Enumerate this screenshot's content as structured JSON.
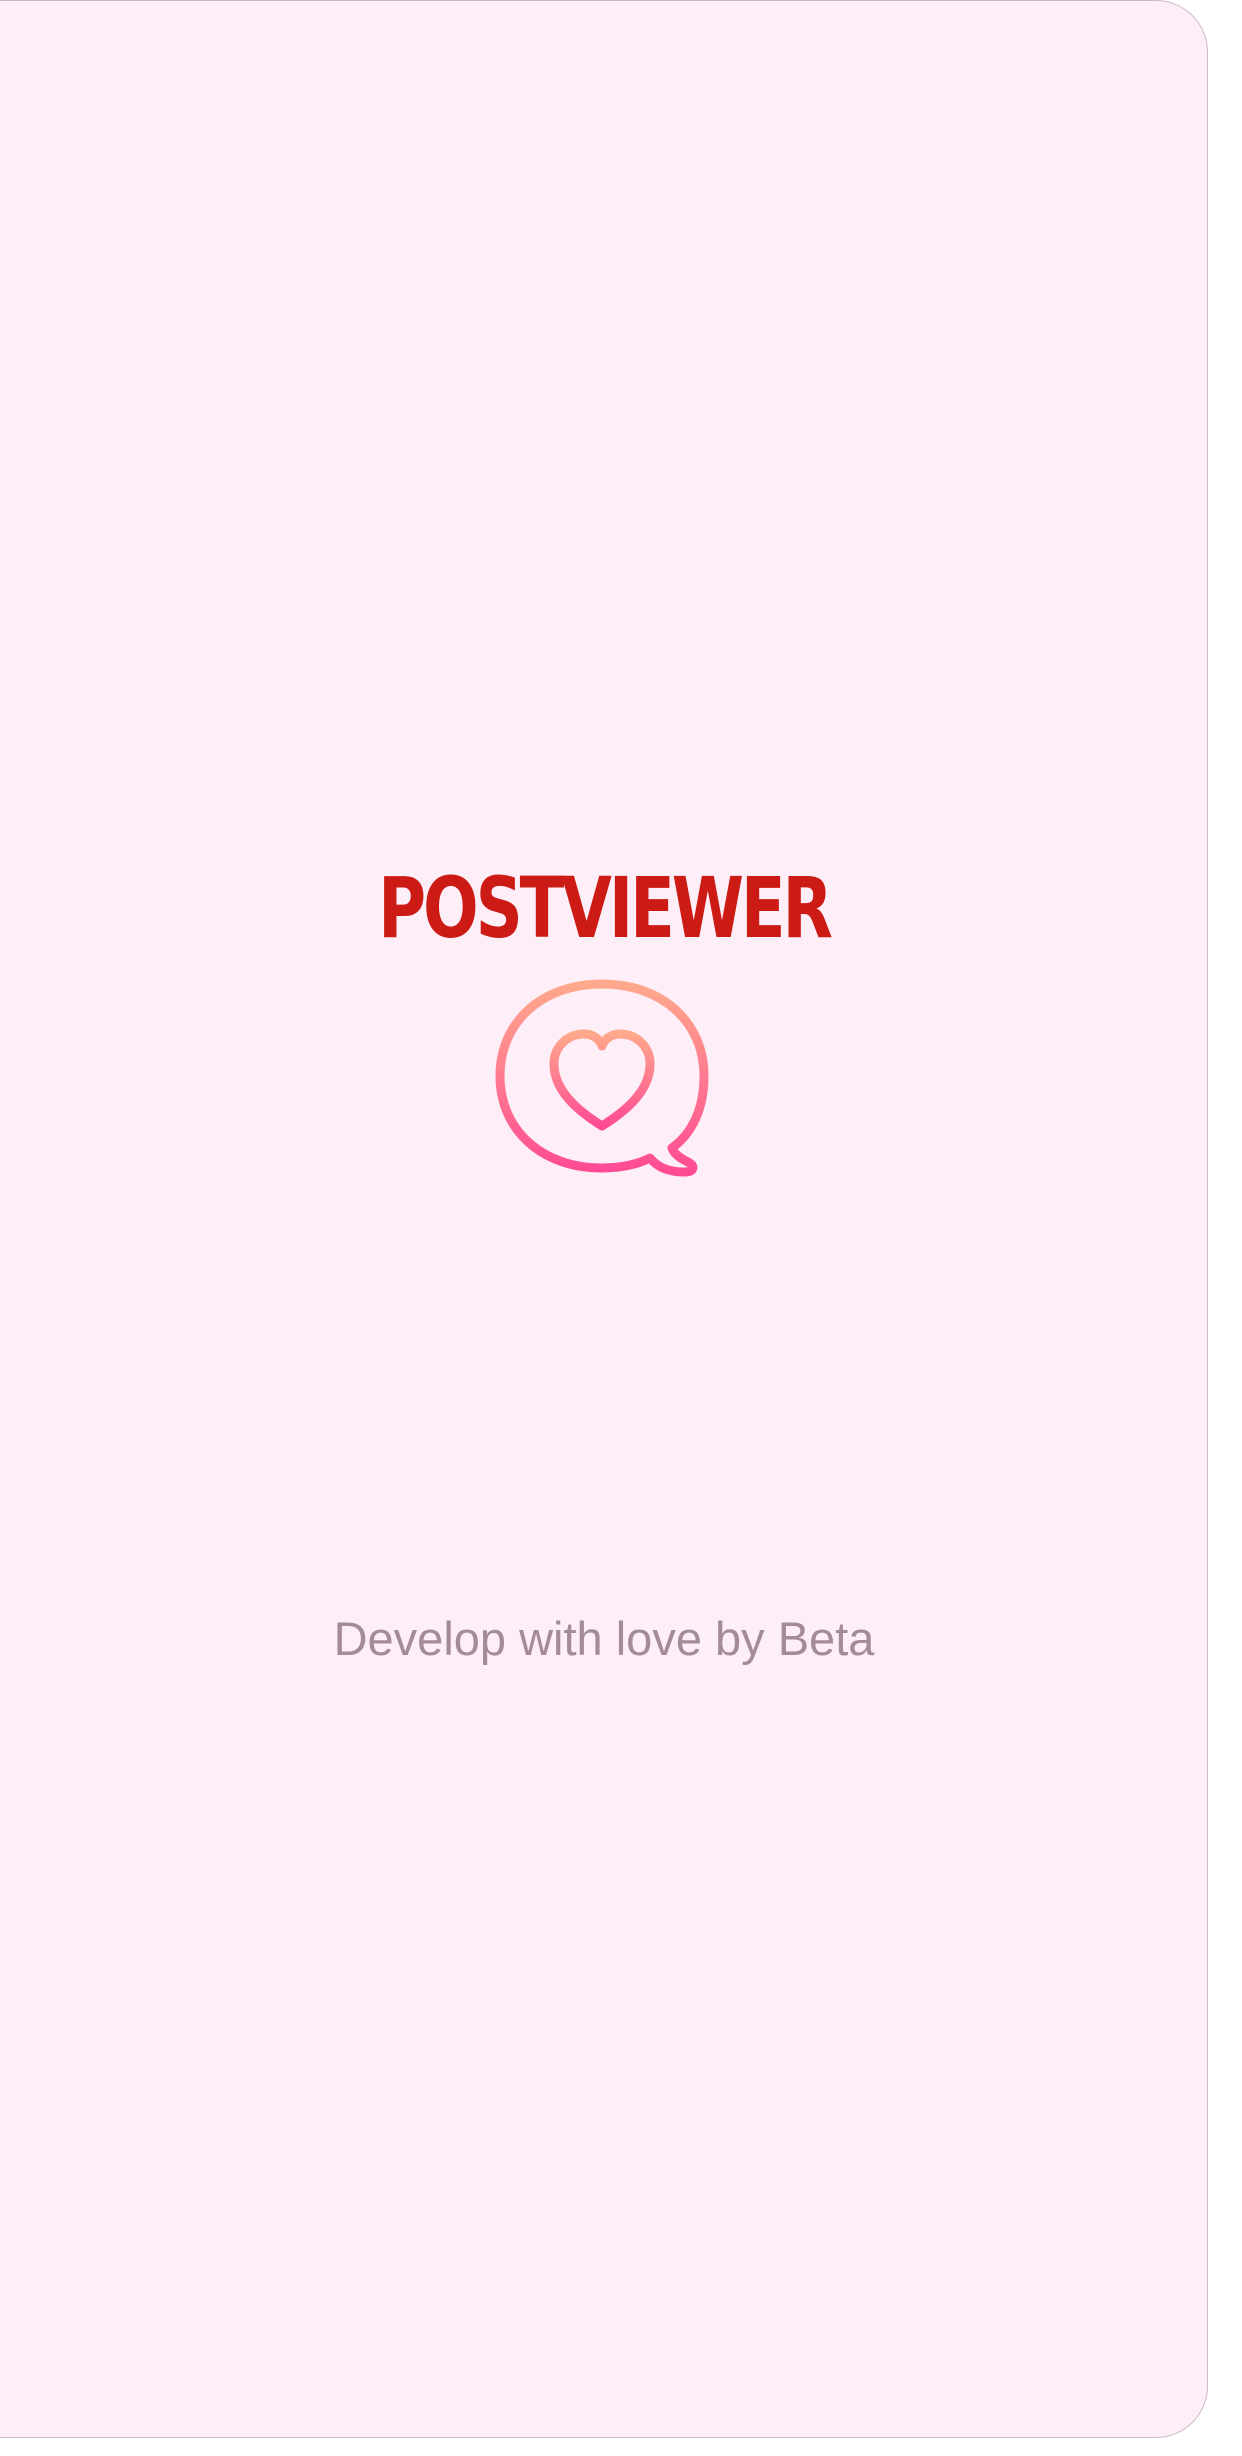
{
  "splash": {
    "app_name": "POSTVIEWER",
    "logo_icon": "chat-bubble-heart-icon",
    "footer": "Develop with love by Beta"
  },
  "colors": {
    "background": "#fdeef8",
    "app_name": "#cc1a14",
    "icon_gradient_top": "#ffa98c",
    "icon_gradient_bottom": "#ff4b93",
    "footer": "#a48b9c"
  }
}
